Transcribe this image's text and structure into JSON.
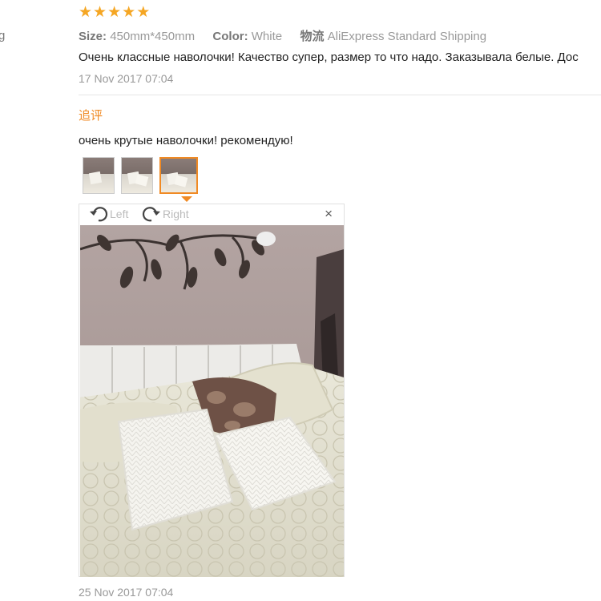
{
  "edge_glyph": "g",
  "rating": {
    "stars": [
      "★",
      "★",
      "★",
      "★",
      "★"
    ],
    "color": "#f5a623"
  },
  "attributes": {
    "size_label": "Size:",
    "size_value": "450mm*450mm",
    "color_label": "Color:",
    "color_value": "White",
    "shipping_label": "物流",
    "shipping_value": "AliExpress Standard Shipping"
  },
  "review": {
    "text": "Очень классные наволочки! Качество супер, размер то что надо. Заказывала белые. Дос",
    "date": "17 Nov 2017 07:04"
  },
  "followup": {
    "label": "追评",
    "text": "очень крутые наволочки! рекомендую!",
    "thumbnails": [
      "thumb-1",
      "thumb-2",
      "thumb-3"
    ],
    "active_thumbnail": 3,
    "accent": "#f08a24"
  },
  "viewer": {
    "rotate_left_label": "Left",
    "rotate_right_label": "Right",
    "close_glyph": "×"
  },
  "followup_date": "25 Nov 2017 07:04"
}
